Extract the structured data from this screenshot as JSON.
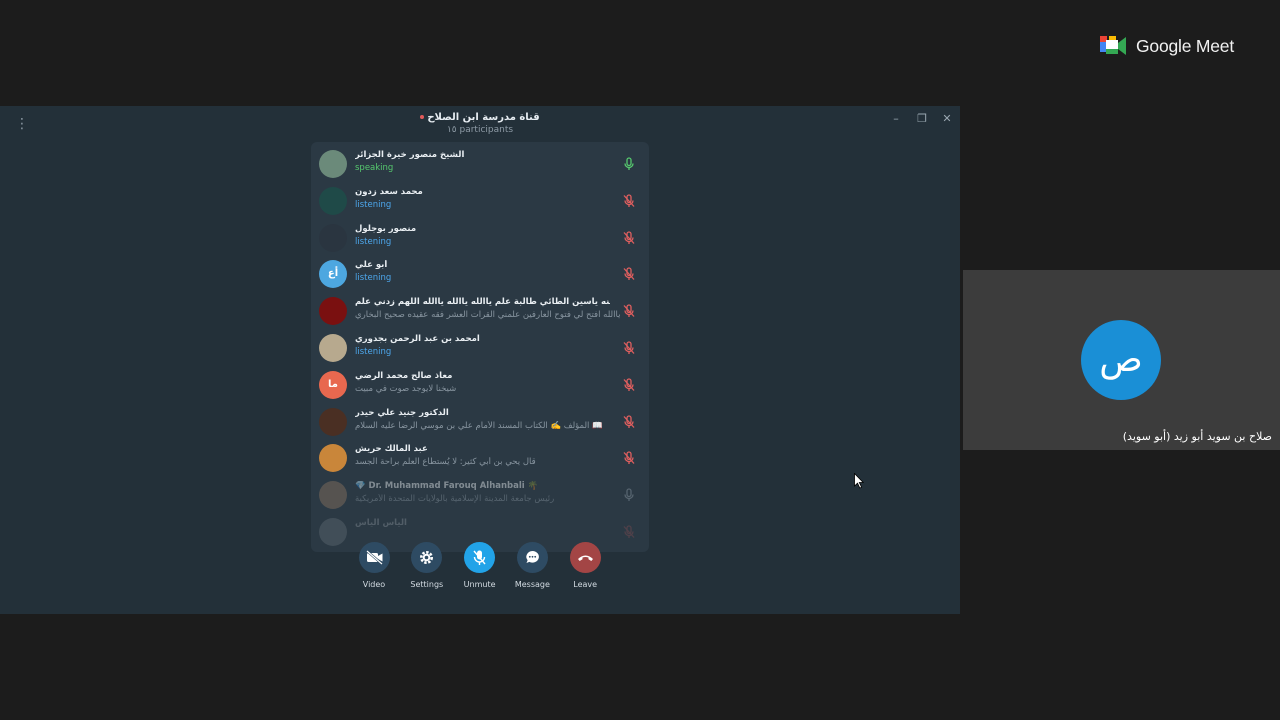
{
  "meet": {
    "brand": "Google Meet",
    "colors": {
      "blue": "#4285f4",
      "green": "#34a853",
      "yellow": "#fbbc04",
      "red": "#ea4335"
    }
  },
  "presenter_tile": {
    "initial": "ص",
    "name": "صلاح بن سويد أبو زيد (أبو سويد)",
    "avatar_color": "#1a8fd6"
  },
  "telegram": {
    "window_buttons": {
      "minimize": "–",
      "restore": "❐",
      "close": "✕"
    },
    "title": "قناة مدرسة ابن الصلاح",
    "subtitle": "١٥ participants",
    "participants": [
      {
        "name": "الشيخ منصور خيرة الجزائر",
        "status": "speaking",
        "kind": "speaking",
        "mic": "on",
        "avatar": {
          "type": "photo",
          "color": "#6b8a7a"
        }
      },
      {
        "name": "محمد سعد زدون",
        "status": "listening",
        "kind": "listening",
        "mic": "muted",
        "avatar": {
          "type": "photo",
          "color": "#1f4a48"
        }
      },
      {
        "name": "منصور بوجلول",
        "status": "listening",
        "kind": "listening",
        "mic": "muted",
        "avatar": {
          "type": "photo",
          "color": "#2a3540"
        }
      },
      {
        "name": "أبو علي",
        "status": "listening",
        "kind": "listening",
        "mic": "muted",
        "avatar": {
          "type": "initials",
          "initials": "أع",
          "color": "#4da7e0"
        }
      },
      {
        "name": "حسينه ياسين الطائي طالبة علم ياالله ياالله ياالله اللهم زدني علم",
        "status": "ياالله افتح لي فتوح العارفين علمني القرات العشر فقه عقيده صحيح البخاري",
        "kind": "about",
        "mic": "muted",
        "avatar": {
          "type": "photo",
          "color": "#7a1010"
        }
      },
      {
        "name": "امحمد بن عبد الرحمن بجدوري",
        "status": "listening",
        "kind": "listening",
        "mic": "muted",
        "avatar": {
          "type": "photo",
          "color": "#b7a98e"
        }
      },
      {
        "name": "معاذ صالح محمد الرضي",
        "status": "شيخنا لايوجد صوت في مبيت",
        "kind": "about",
        "mic": "muted",
        "avatar": {
          "type": "initials",
          "initials": "ما",
          "color": "#e8684f"
        }
      },
      {
        "name": "الدكتور جنيد علي حيدر",
        "status": "المؤلف ✍️ الكتاب المسند الأمام علي بن موسي الرضا عليه السلام 📖",
        "kind": "about",
        "mic": "muted",
        "avatar": {
          "type": "photo",
          "color": "#4a2f23"
        }
      },
      {
        "name": "عبد المالك حريش",
        "status": "قال يحي بن أبي كثير: لا يُستطاع العلم براحة الجسد",
        "kind": "about",
        "mic": "muted",
        "avatar": {
          "type": "photo",
          "color": "#c9863a"
        }
      },
      {
        "name": "💎 Dr. Muhammad Farouq Alhanbali 🌴",
        "status": "رئيس جامعة المدينة الإسلامية بالولايات المتحدة الأمريكية",
        "kind": "about",
        "mic": "off",
        "avatar": {
          "type": "photo",
          "color": "#8a7460"
        }
      },
      {
        "name": "الياس الياس",
        "status": "",
        "kind": "about",
        "mic": "muted",
        "avatar": {
          "type": "photo",
          "color": "#9aa3a8"
        }
      }
    ],
    "controls": [
      {
        "id": "video",
        "label": "Video",
        "color": "#2e4b63"
      },
      {
        "id": "settings",
        "label": "Settings",
        "color": "#2e4b63"
      },
      {
        "id": "unmute",
        "label": "Unmute",
        "color": "#22a3e8"
      },
      {
        "id": "message",
        "label": "Message",
        "color": "#2e4b63"
      },
      {
        "id": "leave",
        "label": "Leave",
        "color": "#a34545"
      }
    ]
  }
}
